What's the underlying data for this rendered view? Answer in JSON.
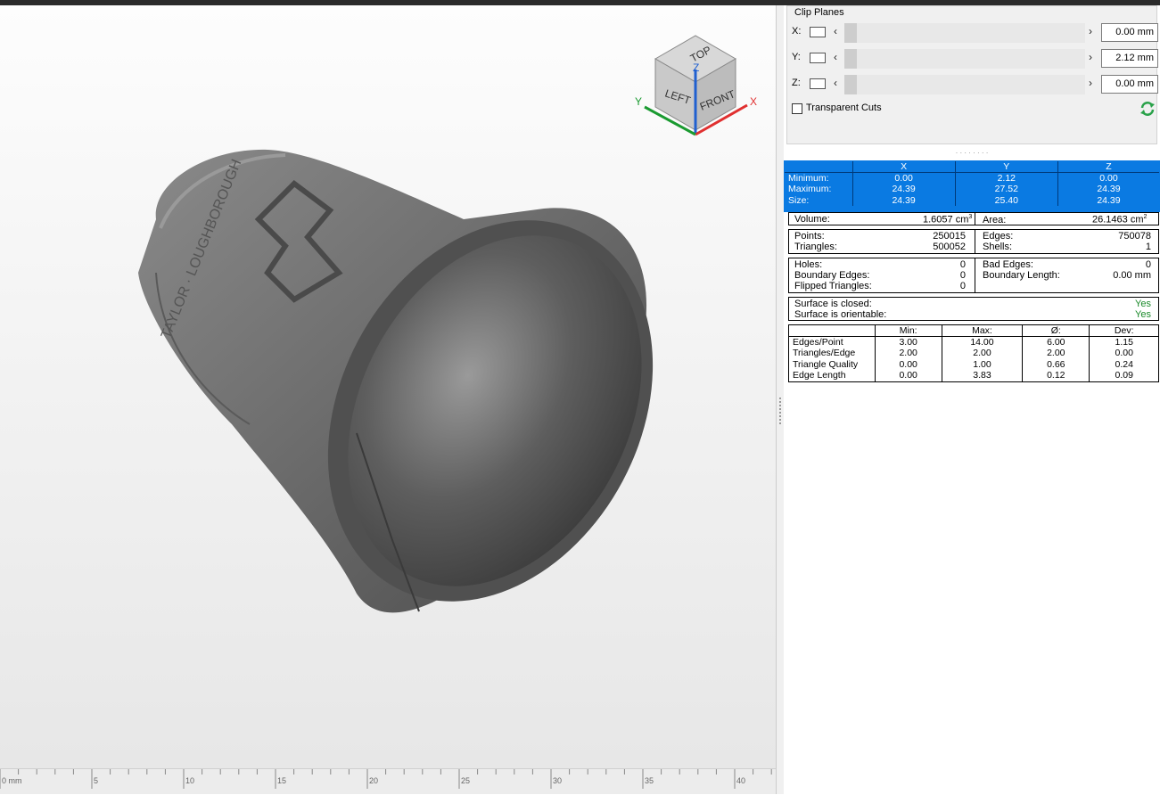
{
  "viewcube": {
    "top": "TOP",
    "left": "LEFT",
    "front": "FRONT",
    "x_axis": "X",
    "y_axis": "Y",
    "z_axis": "Z",
    "colors": {
      "x": "#e03030",
      "y": "#1a9a30",
      "z": "#2060d0"
    }
  },
  "ruler": {
    "ticks": [
      "0 mm",
      "5",
      "10",
      "15",
      "20",
      "25",
      "30",
      "35",
      "40"
    ]
  },
  "clip_planes": {
    "title": "Clip Planes",
    "rows": [
      {
        "axis": "X:",
        "value": "0.00 mm"
      },
      {
        "axis": "Y:",
        "value": "2.12 mm"
      },
      {
        "axis": "Z:",
        "value": "0.00 mm"
      }
    ],
    "transparent_cuts": "Transparent Cuts",
    "refresh_icon": "refresh-icon",
    "accent": "#2aa24a"
  },
  "bounding_box": {
    "headers": [
      "X",
      "Y",
      "Z"
    ],
    "rows": [
      {
        "label": "Minimum:",
        "x": "0.00",
        "y": "2.12",
        "z": "0.00"
      },
      {
        "label": "Maximum:",
        "x": "24.39",
        "y": "27.52",
        "z": "24.39"
      },
      {
        "label": "Size:",
        "x": "24.39",
        "y": "25.40",
        "z": "24.39"
      }
    ],
    "highlight": "#0a7ae2"
  },
  "volume": {
    "label": "Volume:",
    "value": "1.6057 cm",
    "unit_sup": "3",
    "area_label": "Area:",
    "area_value": "26.1463 cm",
    "area_sup": "2"
  },
  "counts": {
    "points_label": "Points:",
    "points": "250015",
    "triangles_label": "Triangles:",
    "triangles": "500052",
    "edges_label": "Edges:",
    "edges": "750078",
    "shells_label": "Shells:",
    "shells": "1"
  },
  "defects": {
    "holes_label": "Holes:",
    "holes": "0",
    "boundary_edges_label": "Boundary Edges:",
    "boundary_edges": "0",
    "flipped_label": "Flipped Triangles:",
    "flipped": "0",
    "bad_edges_label": "Bad Edges:",
    "bad_edges": "0",
    "boundary_length_label": "Boundary Length:",
    "boundary_length": "0.00 mm"
  },
  "surface": {
    "closed_label": "Surface is closed:",
    "closed": "Yes",
    "orientable_label": "Surface is orientable:",
    "orientable": "Yes"
  },
  "stats": {
    "headers": [
      "",
      "Min:",
      "Max:",
      "Ø:",
      "Dev:"
    ],
    "rows": [
      {
        "label": "Edges/Point",
        "min": "3.00",
        "max": "14.00",
        "avg": "6.00",
        "dev": "1.15"
      },
      {
        "label": "Triangles/Edge",
        "min": "2.00",
        "max": "2.00",
        "avg": "2.00",
        "dev": "0.00"
      },
      {
        "label": "Triangle Quality",
        "min": "0.00",
        "max": "1.00",
        "avg": "0.66",
        "dev": "0.24"
      },
      {
        "label": "Edge Length",
        "min": "0.00",
        "max": "3.83",
        "avg": "0.12",
        "dev": "0.09"
      }
    ]
  }
}
